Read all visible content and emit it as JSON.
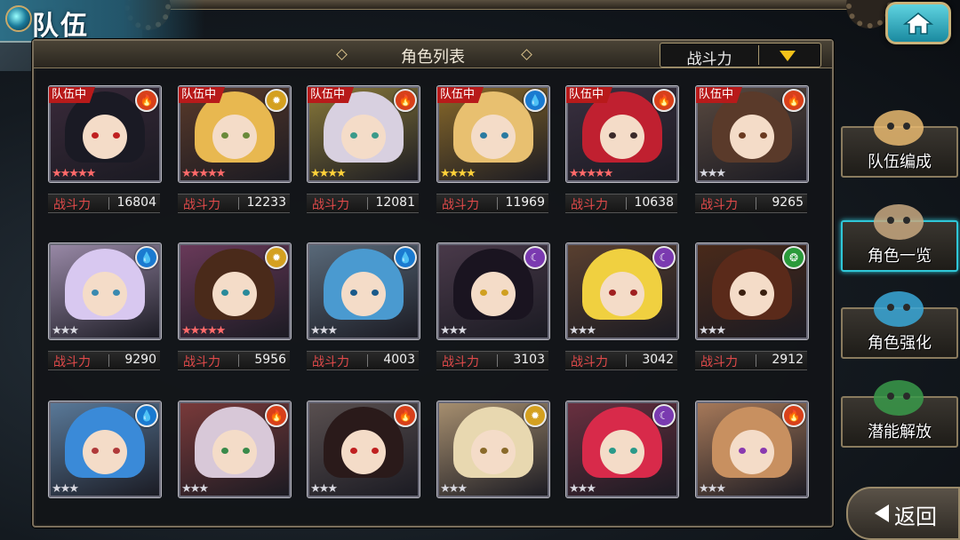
{
  "header": {
    "title": "队伍"
  },
  "panel": {
    "title": "角色列表",
    "sort": {
      "selected": "战斗力"
    }
  },
  "colors": {
    "team_badge": "#b81a1a",
    "fire": "#d8401a",
    "water": "#1a7ad0",
    "light": "#d4a020",
    "dark": "#7a3ab0",
    "wind": "#2a9a3a",
    "power_label": "#e04a4a",
    "active_side": "#2fc7d8"
  },
  "side_menu": [
    {
      "label": "队伍编成",
      "icon": "party-portraits-icon",
      "active": false
    },
    {
      "label": "角色一览",
      "icon": "book-icon",
      "active": true
    },
    {
      "label": "角色强化",
      "icon": "upgrade-crystal-icon",
      "active": false
    },
    {
      "label": "潜能解放",
      "icon": "potential-orb-icon",
      "active": false
    }
  ],
  "back": {
    "label": "返回"
  },
  "power_label": "战斗力",
  "characters": [
    {
      "in_team": true,
      "team_label": "队伍中",
      "element": "fire",
      "stars": 5,
      "power": "16804",
      "hair": "#1a1a24",
      "eye": "#c02020",
      "bg": "#3a2a3a"
    },
    {
      "in_team": true,
      "team_label": "队伍中",
      "element": "light",
      "stars": 5,
      "power": "12233",
      "hair": "#e8b850",
      "eye": "#6a8a3a",
      "bg": "#5a3a2a"
    },
    {
      "in_team": true,
      "team_label": "队伍中",
      "element": "fire",
      "stars": 4,
      "power": "12081",
      "hair": "#d8d0e0",
      "eye": "#3a9a8a",
      "bg": "#8a7a3a"
    },
    {
      "in_team": true,
      "team_label": "队伍中",
      "element": "water",
      "stars": 4,
      "power": "11969",
      "hair": "#e8c070",
      "eye": "#2a7aa0",
      "bg": "#8a6a2a"
    },
    {
      "in_team": true,
      "team_label": "队伍中",
      "element": "fire",
      "stars": 5,
      "power": "10638",
      "hair": "#c02030",
      "eye": "#3a2a2a",
      "bg": "#3a3040"
    },
    {
      "in_team": true,
      "team_label": "队伍中",
      "element": "fire",
      "stars": 3,
      "power": "9265",
      "hair": "#5a3a2a",
      "eye": "#6a3a20",
      "bg": "#5a4a40"
    },
    {
      "in_team": false,
      "element": "water",
      "stars": 3,
      "power": "9290",
      "hair": "#d8c8f0",
      "eye": "#3a8ab0",
      "bg": "#9a8aa8"
    },
    {
      "in_team": false,
      "element": "light",
      "stars": 5,
      "power": "5956",
      "hair": "#4a2a1a",
      "eye": "#2a8a9a",
      "bg": "#6a3a5a"
    },
    {
      "in_team": false,
      "element": "water",
      "stars": 3,
      "power": "4003",
      "hair": "#4a9ad0",
      "eye": "#1a5a8a",
      "bg": "#5a6a7a"
    },
    {
      "in_team": false,
      "element": "dark",
      "stars": 3,
      "power": "3103",
      "hair": "#1a1420",
      "eye": "#d0a020",
      "bg": "#4a3a4a"
    },
    {
      "in_team": false,
      "element": "dark",
      "stars": 3,
      "power": "3042",
      "hair": "#f0d040",
      "eye": "#a02020",
      "bg": "#5a4030"
    },
    {
      "in_team": false,
      "element": "wind",
      "stars": 3,
      "power": "2912",
      "hair": "#5a2a1a",
      "eye": "#3a2010",
      "bg": "#4a2a1a"
    },
    {
      "in_team": false,
      "element": "water",
      "stars": 3,
      "power": "",
      "hair": "#3a8ad8",
      "eye": "#b03a3a",
      "bg": "#5a7a9a"
    },
    {
      "in_team": false,
      "element": "fire",
      "stars": 3,
      "power": "",
      "hair": "#d8c8d8",
      "eye": "#3a8a4a",
      "bg": "#7a3a3a"
    },
    {
      "in_team": false,
      "element": "fire",
      "stars": 3,
      "power": "",
      "hair": "#2a1a1a",
      "eye": "#c02020",
      "bg": "#5a5050"
    },
    {
      "in_team": false,
      "element": "light",
      "stars": 3,
      "power": "",
      "hair": "#e8d8b0",
      "eye": "#8a6a2a",
      "bg": "#a89070"
    },
    {
      "in_team": false,
      "element": "dark",
      "stars": 3,
      "power": "",
      "hair": "#d82a4a",
      "eye": "#2a9a8a",
      "bg": "#6a3040"
    },
    {
      "in_team": false,
      "element": "fire",
      "stars": 3,
      "power": "",
      "hair": "#c89060",
      "eye": "#8a3ab0",
      "bg": "#a87a5a"
    }
  ]
}
